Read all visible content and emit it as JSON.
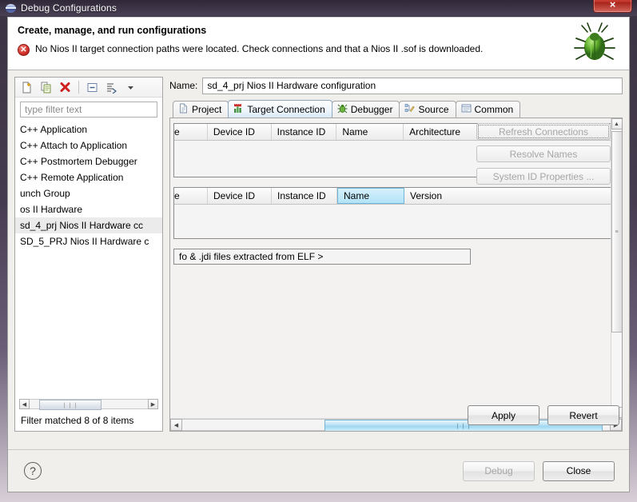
{
  "window": {
    "title": "Debug Configurations",
    "icon": "eclipse-globe-icon",
    "close_label": "×"
  },
  "header": {
    "title": "Create, manage, and run configurations",
    "error_icon": "error-circle-icon",
    "error_symbol": "✕",
    "message": "No Nios II target connection paths were located. Check connections and that a Nios II .sof is downloaded.",
    "decor_icon": "green-bug-icon"
  },
  "tree_panel": {
    "toolbar": [
      {
        "name": "new-configuration-icon",
        "title": "New launch configuration"
      },
      {
        "name": "duplicate-configuration-icon",
        "title": "Duplicate"
      },
      {
        "name": "delete-configuration-icon",
        "title": "Delete"
      },
      {
        "name": "collapse-all-icon",
        "title": "Collapse All"
      },
      {
        "name": "filter-configurations-icon",
        "title": "Filter"
      },
      {
        "name": "chevron-down-icon",
        "title": "View menu"
      }
    ],
    "filter_placeholder": "type filter text",
    "items": [
      {
        "label": "C++ Application",
        "selected": false
      },
      {
        "label": "C++ Attach to Application",
        "selected": false
      },
      {
        "label": "C++ Postmortem Debugger",
        "selected": false
      },
      {
        "label": "C++ Remote Application",
        "selected": false
      },
      {
        "label": "unch Group",
        "selected": false
      },
      {
        "label": "os II Hardware",
        "selected": false
      },
      {
        "label": "sd_4_prj Nios II Hardware cc",
        "selected": true
      },
      {
        "label": "SD_5_PRJ Nios II Hardware c",
        "selected": false
      }
    ],
    "status": "Filter matched 8 of 8 items",
    "scroll_glyph": "❘❘❘",
    "left_arrow": "◀",
    "right_arrow": "▶"
  },
  "config": {
    "name_label": "Name:",
    "name_value": "sd_4_prj Nios II Hardware configuration",
    "tabs": [
      {
        "label": "Project",
        "icon": "project-file-icon",
        "active": false
      },
      {
        "label": "Target Connection",
        "icon": "target-connection-icon",
        "active": true
      },
      {
        "label": "Debugger",
        "icon": "debugger-bug-icon",
        "active": false
      },
      {
        "label": "Source",
        "icon": "source-lookup-icon",
        "active": false
      },
      {
        "label": "Common",
        "icon": "common-list-icon",
        "active": false
      }
    ]
  },
  "target_connection": {
    "connections_table": {
      "columns": [
        "e",
        "Device ID",
        "Instance ID",
        "Name",
        "Architecture"
      ],
      "rows": []
    },
    "system_table": {
      "columns": [
        "e",
        "Device ID",
        "Instance ID",
        "Name",
        "Version"
      ],
      "highlighted_column": "Name",
      "rows": []
    },
    "elf_field_text": "fo & .jdi files extracted from ELF >",
    "side_buttons": [
      {
        "label": "Refresh Connections",
        "enabled": false,
        "focused": true
      },
      {
        "label": "Resolve Names",
        "enabled": false,
        "focused": false
      },
      {
        "label": "System ID Properties ...",
        "enabled": false,
        "focused": false
      }
    ],
    "hscroll_glyph": "❘❘❘",
    "vscroll_glyph": "≡",
    "up_arrow": "▲",
    "down_arrow": "▼",
    "left_arrow": "◀",
    "right_arrow": "▶"
  },
  "actions": {
    "apply": "Apply",
    "revert": "Revert"
  },
  "footer": {
    "help_icon": "help-question-icon",
    "help_symbol": "?",
    "debug": "Debug",
    "close": "Close"
  },
  "colors": {
    "titlebar": "#3c3447",
    "close_button": "#c2362c",
    "error_red": "#d0312a",
    "tab_active": "#d8e9f7",
    "scroll_thumb_blue": "#b7e1f4",
    "column_highlight": "#b2e3f7"
  }
}
